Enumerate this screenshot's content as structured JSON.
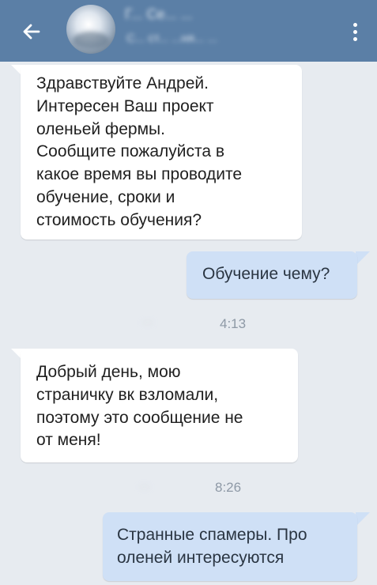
{
  "header": {
    "title": "Г... Се... ...",
    "subtitle": "С... ст... ...ня... ...",
    "back_icon": "arrow-left-icon",
    "menu_icon": "more-vertical-icon"
  },
  "messages": [
    {
      "direction": "incoming",
      "text": "Здравствуйте Андрей.\nИнтересен Ваш проект\nоленьей фермы.\nСообщите пожалуйста в\nкакое время вы проводите\nобучение, сроки и\nстоимость обучения?"
    },
    {
      "direction": "outgoing",
      "text": "Обучение чему?"
    },
    {
      "direction": "incoming",
      "text": "Добрый день, мою\nстраничку вк взломали,\nпоэтому это сообщение не\nот меня!"
    },
    {
      "direction": "outgoing",
      "text": "Странные спамеры. Про\nоленей интересуются"
    }
  ],
  "stamps": [
    {
      "sender": "...",
      "time": "4:13"
    },
    {
      "sender": "...",
      "time": "8:26"
    }
  ],
  "colors": {
    "header": "#5b7fa6",
    "background": "#e7ebf0",
    "incoming_bubble": "#ffffff",
    "outgoing_bubble": "#cfe0f6"
  }
}
